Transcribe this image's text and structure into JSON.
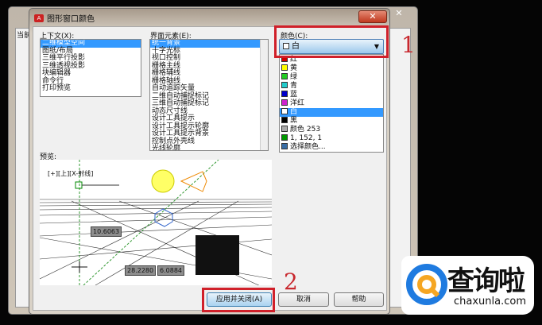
{
  "back_window": {
    "close": "✕",
    "label": "当前"
  },
  "dialog": {
    "title": "图形窗口颜色",
    "close": "✕",
    "context": {
      "label": "上下文(X):",
      "items": [
        "二维模型空间",
        "图纸/布局",
        "三维平行投影",
        "三维透视投影",
        "块编辑器",
        "命令行",
        "打印预览"
      ],
      "selected": 0
    },
    "elements": {
      "label": "界面元素(E):",
      "items": [
        "统一背景",
        "十字光标",
        "视口控制",
        "栅格主线",
        "栅格辅线",
        "栅格轴线",
        "自动追踪矢量",
        "二维自动捕捉标记",
        "三维自动捕捉标记",
        "动态尺寸线",
        "设计工具提示",
        "设计工具提示轮廓",
        "设计工具提示背景",
        "控制点外壳线",
        "光线轮廓"
      ],
      "selected": 0
    },
    "color": {
      "label": "颜色(C):",
      "value": "白",
      "options": [
        {
          "name": "红",
          "swatch": "#d00000"
        },
        {
          "name": "黄",
          "swatch": "#ffff00"
        },
        {
          "name": "绿",
          "swatch": "#22cc22"
        },
        {
          "name": "青",
          "swatch": "#22cccc"
        },
        {
          "name": "蓝",
          "swatch": "#0000cc"
        },
        {
          "name": "洋红",
          "swatch": "#cc22cc"
        },
        {
          "name": "白",
          "swatch": "#ffffff"
        },
        {
          "name": "黑",
          "swatch": "#000000"
        },
        {
          "name": "颜色 253",
          "swatch": "#aaaaaa"
        },
        {
          "name": "1, 152, 1",
          "swatch": "#019801"
        },
        {
          "name": "选择颜色...",
          "swatch": "#3a6ea5"
        }
      ],
      "selected_option": 6
    },
    "preview": {
      "label": "预览:",
      "viewport_label": "[+][上][X-射线]",
      "dims": [
        "10.6063",
        "28.2280",
        "6.0884"
      ]
    },
    "buttons": {
      "apply": "应用并关闭(A)",
      "cancel": "取消",
      "help": "帮助"
    }
  },
  "annotations": {
    "step1": "1",
    "step2": "2"
  },
  "watermark": {
    "name": "查询啦",
    "url": "chaxunla.com"
  },
  "colors": {
    "highlight": "#d0202a",
    "selection": "#3399ff"
  }
}
